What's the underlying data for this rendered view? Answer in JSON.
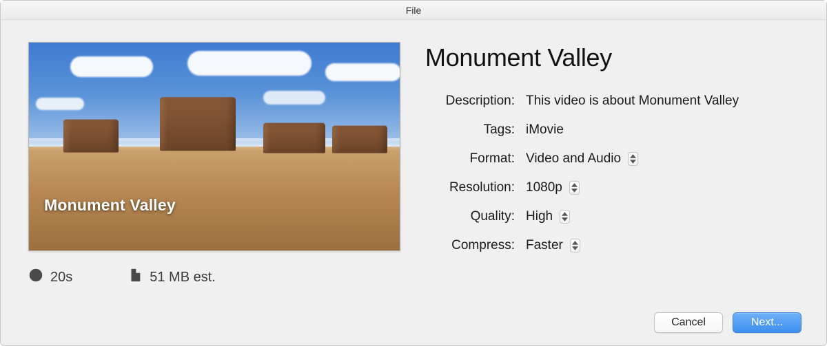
{
  "window": {
    "title": "File"
  },
  "thumbnail": {
    "caption": "Monument Valley"
  },
  "meta": {
    "duration": "20s",
    "filesize": "51 MB est."
  },
  "movie": {
    "title": "Monument Valley"
  },
  "form": {
    "description": {
      "label": "Description:",
      "value": "This video is about Monument Valley"
    },
    "tags": {
      "label": "Tags:",
      "value": "iMovie"
    },
    "format": {
      "label": "Format:",
      "value": "Video and Audio"
    },
    "resolution": {
      "label": "Resolution:",
      "value": "1080p"
    },
    "quality": {
      "label": "Quality:",
      "value": "High"
    },
    "compress": {
      "label": "Compress:",
      "value": "Faster"
    }
  },
  "buttons": {
    "cancel": "Cancel",
    "next": "Next..."
  }
}
